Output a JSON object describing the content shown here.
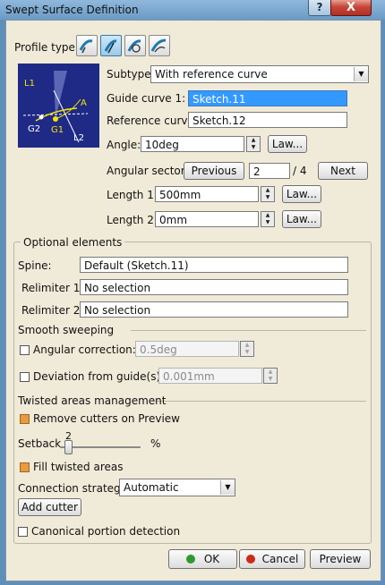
{
  "window": {
    "title": "Swept Surface Definition",
    "help_label": "?",
    "close_label": "X"
  },
  "profile": {
    "label": "Profile type:",
    "icons": [
      "explicit-profile-icon",
      "line-profile-icon",
      "circle-profile-icon",
      "conic-profile-icon"
    ],
    "selected_index": 1
  },
  "diagram": {
    "labels": [
      "L1",
      "A",
      "G2",
      "G1",
      "L2"
    ]
  },
  "subtype": {
    "label": "Subtype:",
    "value": "With reference curve"
  },
  "guide_curve": {
    "label": "Guide curve 1:",
    "value": "Sketch.11"
  },
  "reference_curve": {
    "label": "Reference curve:",
    "value": "Sketch.12"
  },
  "angle": {
    "label": "Angle:",
    "value": "10deg",
    "law_label": "Law..."
  },
  "angular_sector": {
    "label": "Angular sector:",
    "previous_label": "Previous",
    "value": "2",
    "total": "/ 4",
    "next_label": "Next"
  },
  "length1": {
    "label": "Length 1:",
    "value": "500mm",
    "law_label": "Law..."
  },
  "length2": {
    "label": "Length 2:",
    "value": "0mm",
    "law_label": "Law..."
  },
  "optional": {
    "title": "Optional elements",
    "spine_label": "Spine:",
    "spine_value": "Default (Sketch.11)",
    "relimiter1_label": "Relimiter 1:",
    "relimiter1_value": "No selection",
    "relimiter2_label": "Relimiter 2:",
    "relimiter2_value": "No selection"
  },
  "smooth": {
    "title": "Smooth sweeping",
    "angular_correction_label": "Angular correction:",
    "angular_correction_value": "0.5deg",
    "deviation_label": "Deviation from guide(s):",
    "deviation_value": "0.001mm"
  },
  "twisted": {
    "title": "Twisted areas management",
    "remove_cutters_label": "Remove cutters on Preview",
    "setback_label": "Setback",
    "setback_value": "2",
    "setback_unit": "%",
    "fill_label": "Fill twisted areas",
    "connection_label": "Connection strategy:",
    "connection_value": "Automatic",
    "add_cutter_label": "Add cutter"
  },
  "canonical_label": "Canonical portion detection",
  "footer": {
    "ok_label": "OK",
    "cancel_label": "Cancel",
    "preview_label": "Preview"
  },
  "colors": {
    "ok": "#2e9a2e",
    "cancel": "#cc2a1a",
    "check_on": "#e89a40",
    "diagram_bg": "#1f2a86"
  }
}
